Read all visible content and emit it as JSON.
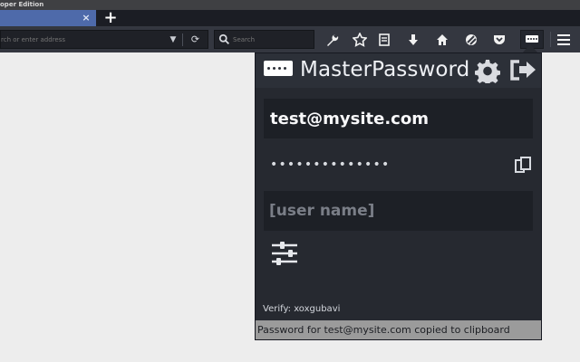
{
  "window": {
    "title_fragment": "oper Edition"
  },
  "tab": {
    "close_symbol": "×"
  },
  "toolbar": {
    "new_tab_symbol": "+",
    "address_placeholder": "rch or enter address",
    "search_placeholder": "Search"
  },
  "popup": {
    "title": "MasterPassword",
    "site_value": "test@mysite.com",
    "password_mask": "••••••••••••••",
    "username_placeholder": "[user name]",
    "verify_text": "Verify: xoxgubavi",
    "status_message": "Password for test@mysite.com copied to clipboard"
  }
}
